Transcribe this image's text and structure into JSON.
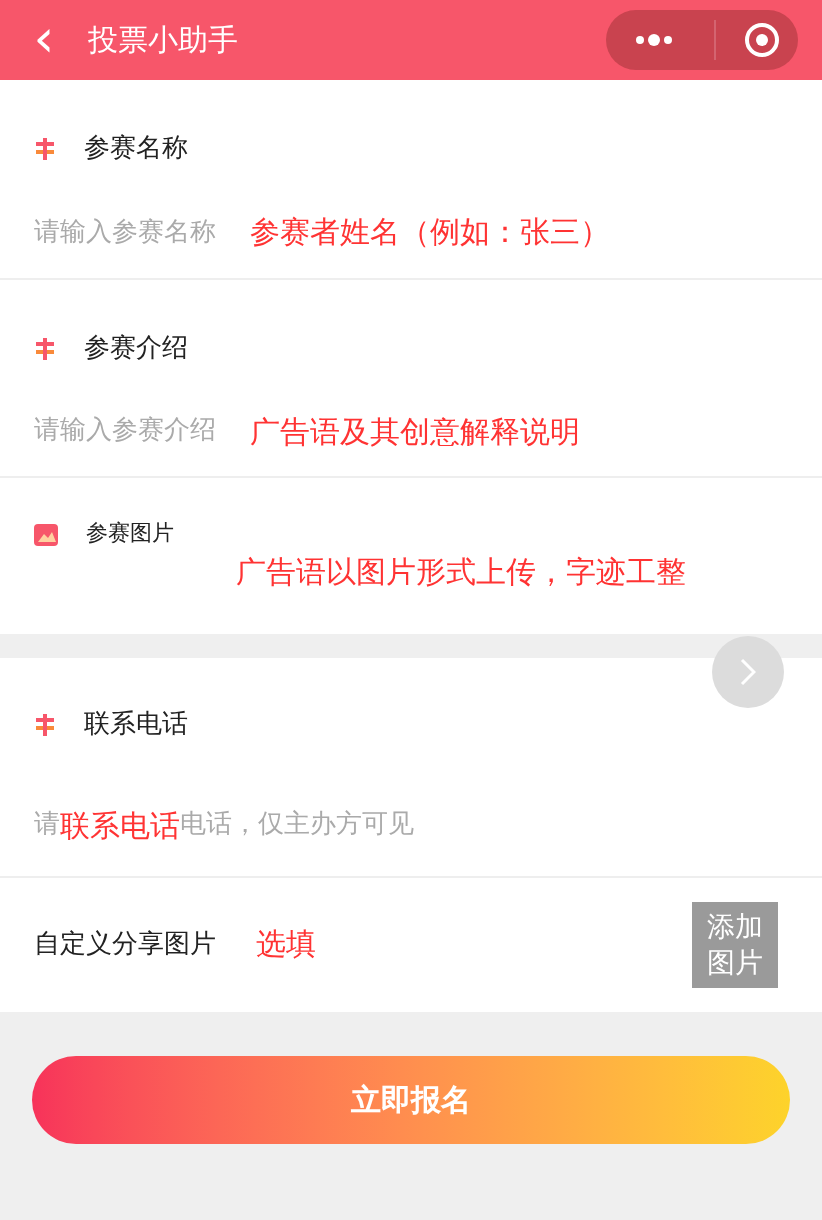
{
  "header": {
    "back": "‹",
    "title": "投票小助手"
  },
  "fields": [
    {
      "kind": "text",
      "label": "参赛名称",
      "placeholder": "请输入参赛名称",
      "note": "参赛者姓名（例如：张三）"
    },
    {
      "kind": "text",
      "label": "参赛介绍",
      "placeholder": "请输入参赛介绍",
      "note": "广告语及其创意解释说明"
    },
    {
      "kind": "image",
      "label": "参赛图片",
      "note": "广告语以图片形式上传，字迹工整"
    }
  ],
  "phone": {
    "label": "联系电话",
    "placeholder_start": "请",
    "note": "联系电话",
    "placeholder_end": "电话，仅主办方可见"
  },
  "share": {
    "label": "自定义分享图片",
    "note": "选填",
    "add_button": "添加图片"
  },
  "submit": "立即报名"
}
